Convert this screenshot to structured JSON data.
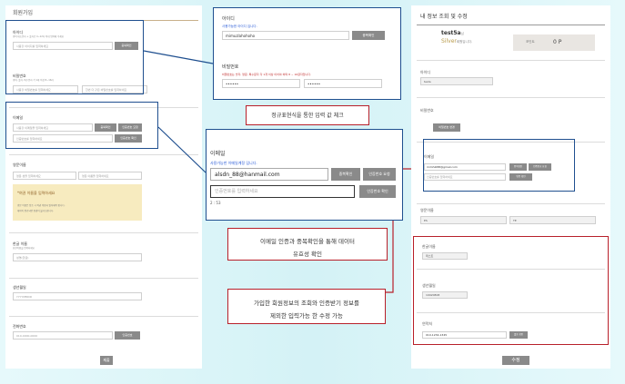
{
  "signup": {
    "title": "회원가입",
    "id_label": "아이디",
    "id_hint": "영어 대소문자 + 숫자로 4~12자 이내 입력해 주세요",
    "id_placeholder": "사용할 아이디를 입력하세요",
    "id_check_btn": "중복확인",
    "pw_label": "비밀번호",
    "pw_hint": "영어, 숫자, 특수문자 각 1개 이상 8~16자",
    "pw_placeholder": "사용할 비밀번호를 입력하세요",
    "pw_confirm_placeholder": "한번 더 같은 비밀번호를 입력하세요",
    "email_label": "이메일",
    "email_placeholder": "사용할 이메일을 입력하세요",
    "email_check_btn": "중복확인",
    "send_code_btn": "인증번호 요청",
    "code_placeholder": "인증번호를 입력하세요",
    "verify_btn": "인증번호 확인",
    "english_name_label": "영문이름",
    "first_name_placeholder": "영문 성을 입력하세요",
    "last_name_placeholder": "영문 이름을 입력하세요",
    "notice_title": "*여권 이름을 입력하세요",
    "notice_body_1": "영문 이름은 탑승 시 여권 이름과 일치해야 합니다.",
    "notice_body_2": "예약이 완료되면 변경이 불가능합니다.",
    "korean_name_label": "한글 이름",
    "korean_name_hint": "한글이름을 입력하세요",
    "korean_name_placeholder": "성명(한글)",
    "birth_label": "생년월일",
    "birth_placeholder": "YYYYMMDD",
    "phone_label": "전화번호",
    "phone_placeholder": "010-0000-0000",
    "phone_btn": "인증번호",
    "submit_btn": "제출"
  },
  "zoom_id": {
    "label": "아이디",
    "hint": "사용가능한 아이디 입니다.",
    "value": "mimuzlahohoho",
    "btn": "중복확인"
  },
  "zoom_pw": {
    "label": "비밀번호",
    "hint": "비밀번호는 숫자, 영문, 특수문자 각 1개 이상 이어야 하며 8 ~ 16글자입니다.",
    "value1": "••••••",
    "value2": "••••••"
  },
  "zoom_email": {
    "label": "이메일",
    "hint": "사용가능한 이메일계정 입니다.",
    "value": "alsdn_88@hanmail.com",
    "dup_btn": "중복확인",
    "send_btn": "인증번호 요청",
    "code_placeholder": "인증번호를 입력하세요",
    "verify_btn": "인증번호 확인",
    "timer": "2 : 53"
  },
  "annotations": {
    "regex": "정규표현식을 통한 입력 값 체크",
    "email_verify_1": "이메일 인증과 중복확인을 통해 데이터",
    "email_verify_2": "유효성 확인",
    "edit_1": "가입한 회원정보의 조회와 인증받기 정보를",
    "edit_2": "제외한 입력가능 한 수정 가능"
  },
  "profile": {
    "title": "내 정보 조회 및 수정",
    "username": "test5a",
    "username_suffix": "님",
    "grade": "Silver",
    "grade_suffix": "회원입니다.",
    "point_label": "포인트",
    "point_value": "0 P",
    "id_label": "아이디",
    "id_value": "testa",
    "pw_label": "비밀번호",
    "pw_btn": "비밀번호 변경",
    "email_label": "이메일",
    "email_value": "mimhi088@gmail.com",
    "email_dup_btn": "중복확인",
    "email_send_btn": "인증번호 요청",
    "email_code_placeholder": "인증번호를 입력하세요",
    "email_verify_btn": "인증 확인",
    "english_name_label": "영문이름",
    "english_first": "ES",
    "english_last": "TE",
    "korean_name_label": "한글이름",
    "korean_name_value": "테스트",
    "birth_label": "생년월일",
    "birth_value": "19920808",
    "phone_label": "연락처",
    "phone_value": "010-1234-1345",
    "phone_btn": "발송 확인",
    "submit_btn": "수정"
  },
  "colors": {
    "callout_blue": "#1f4f8f",
    "callout_red": "#b8202a",
    "button_gray": "#8a8a8a",
    "notice_bg": "#f7ebbf"
  }
}
